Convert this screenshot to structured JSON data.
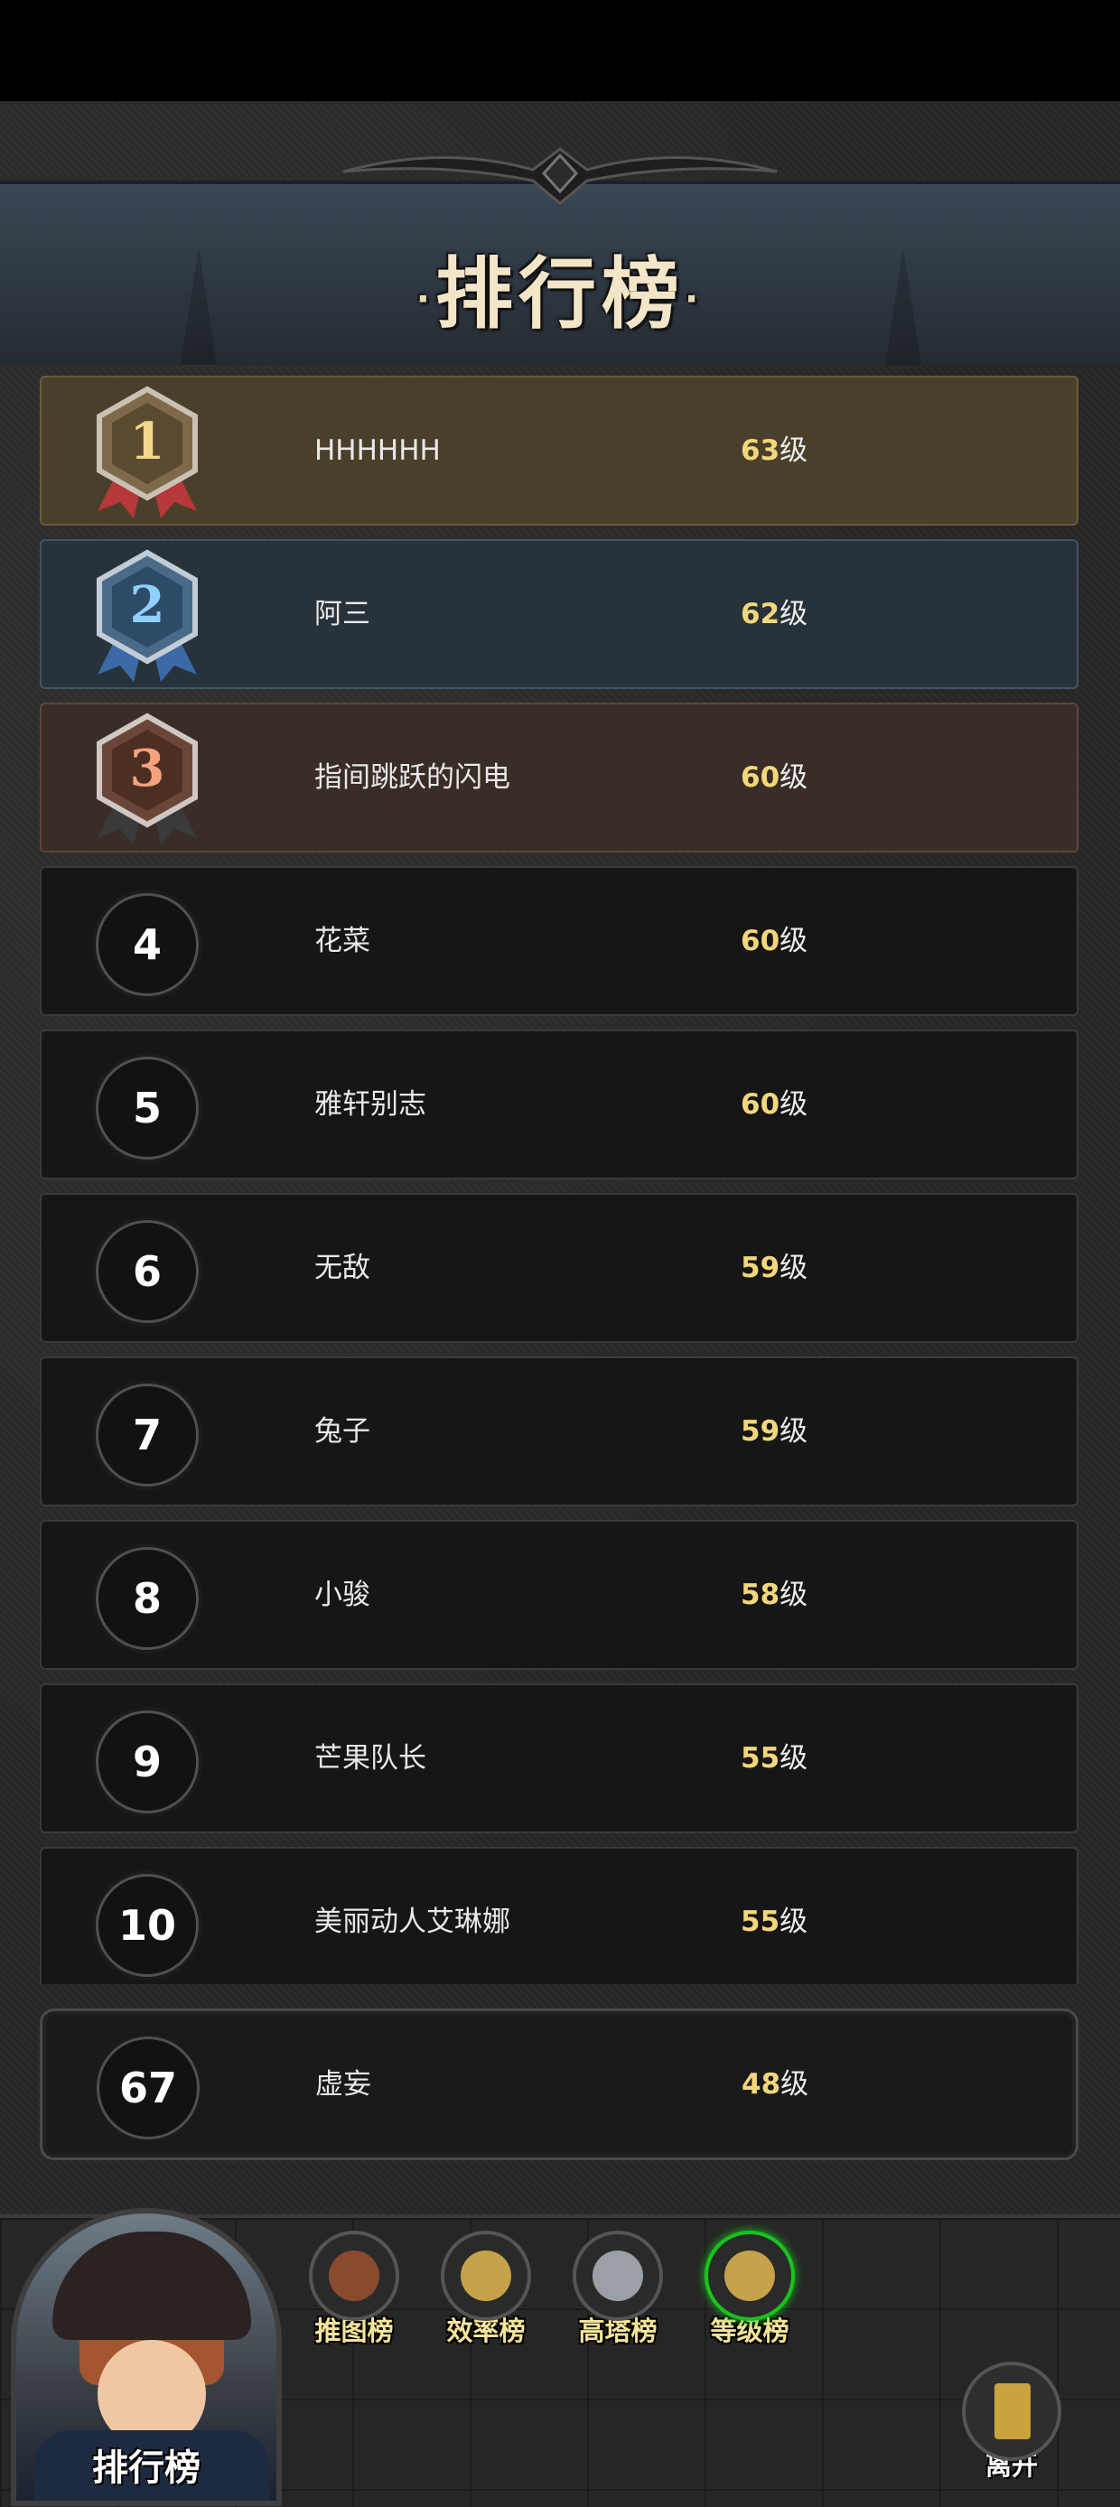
{
  "header": {
    "title": "排行榜"
  },
  "rankings": [
    {
      "rank": "1",
      "name": "HHHHHH",
      "level": "63",
      "unit": "级"
    },
    {
      "rank": "2",
      "name": "阿三",
      "level": "62",
      "unit": "级"
    },
    {
      "rank": "3",
      "name": "指间跳跃的闪电",
      "level": "60",
      "unit": "级"
    },
    {
      "rank": "4",
      "name": "花菜",
      "level": "60",
      "unit": "级"
    },
    {
      "rank": "5",
      "name": "雅轩别志",
      "level": "60",
      "unit": "级"
    },
    {
      "rank": "6",
      "name": "无敌",
      "level": "59",
      "unit": "级"
    },
    {
      "rank": "7",
      "name": "兔子",
      "level": "59",
      "unit": "级"
    },
    {
      "rank": "8",
      "name": "小骏",
      "level": "58",
      "unit": "级"
    },
    {
      "rank": "9",
      "name": "芒果队长",
      "level": "55",
      "unit": "级"
    },
    {
      "rank": "10",
      "name": "美丽动人艾琳娜",
      "level": "55",
      "unit": "级"
    }
  ],
  "self": {
    "rank": "67",
    "name": "虚妄",
    "level": "48",
    "unit": "级"
  },
  "footer": {
    "portrait_label": "排行榜",
    "tabs": [
      {
        "label": "推图榜",
        "icon": "map-icon"
      },
      {
        "label": "效率榜",
        "icon": "clock-icon"
      },
      {
        "label": "高塔榜",
        "icon": "crossed-swords-icon"
      },
      {
        "label": "等级榜",
        "icon": "clock-icon",
        "active": true
      }
    ],
    "exit_label": "离开"
  },
  "colors": {
    "gold_row": "#4a3f2a",
    "silver_row": "#27323b",
    "bronze_row": "#3a2c27",
    "level_number": "#f4d77a",
    "active_tab": "#19c21e",
    "tab_label": "#f4e49a"
  }
}
